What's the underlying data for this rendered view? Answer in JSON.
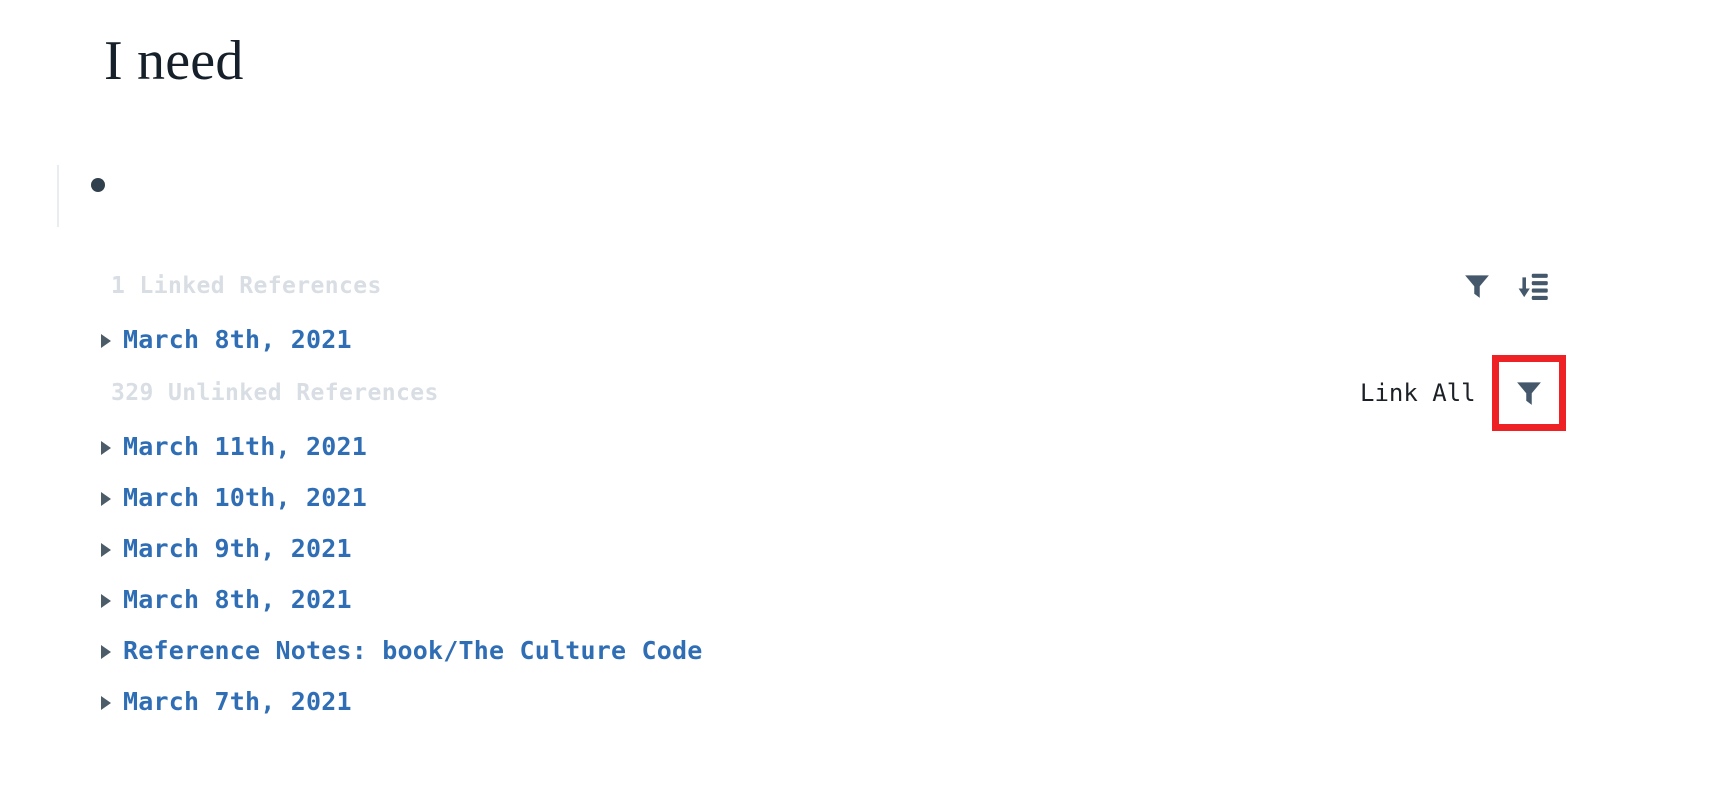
{
  "page": {
    "title": "I need",
    "background_color": "#ffffff"
  },
  "block": {
    "bullet_icon": "bullet-dot",
    "text": ""
  },
  "colors": {
    "title_text": "#16202a",
    "section_header_text": "#d8dee4",
    "reference_link": "#2f6eb5",
    "caret": "#4c5c69",
    "icon": "#45586b",
    "highlight_border": "#ee2124",
    "link_all_text": "#1b2127",
    "guideline": "#e8edf0"
  },
  "linked_references": {
    "header": "1 Linked References",
    "count": 1,
    "controls": {
      "filter_icon": "filter-funnel-icon",
      "sort_icon": "sort-descending-icon"
    },
    "items": [
      {
        "label": "March 8th, 2021",
        "caret_icon": "caret-right-icon",
        "expanded": false
      }
    ]
  },
  "unlinked_references": {
    "header": "329 Unlinked References",
    "count": 329,
    "controls": {
      "link_all_label": "Link All",
      "filter_icon": "filter-funnel-icon",
      "filter_highlighted": true
    },
    "items": [
      {
        "label": "March 11th, 2021",
        "caret_icon": "caret-right-icon",
        "expanded": false
      },
      {
        "label": "March 10th, 2021",
        "caret_icon": "caret-right-icon",
        "expanded": false
      },
      {
        "label": "March 9th, 2021",
        "caret_icon": "caret-right-icon",
        "expanded": false
      },
      {
        "label": "March 8th, 2021",
        "caret_icon": "caret-right-icon",
        "expanded": false
      },
      {
        "label": "Reference Notes: book/The Culture Code",
        "caret_icon": "caret-right-icon",
        "expanded": false
      },
      {
        "label": "March 7th, 2021",
        "caret_icon": "caret-right-icon",
        "expanded": false
      }
    ]
  }
}
